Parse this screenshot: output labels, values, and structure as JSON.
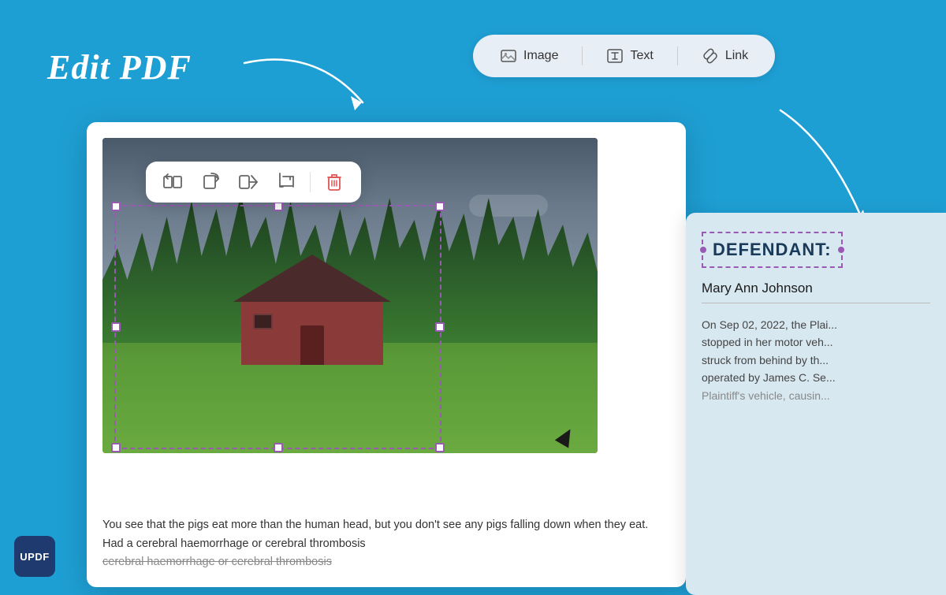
{
  "page": {
    "title": "Edit PDF",
    "background_color": "#1e9fd4"
  },
  "toolbar": {
    "items": [
      {
        "id": "image",
        "label": "Image",
        "icon": "image-icon"
      },
      {
        "id": "text",
        "label": "Text",
        "icon": "text-icon"
      },
      {
        "id": "link",
        "label": "Link",
        "icon": "link-icon"
      }
    ]
  },
  "image_toolbar": {
    "tools": [
      {
        "id": "replace",
        "icon": "replace-icon",
        "tooltip": "Replace"
      },
      {
        "id": "rotate-right",
        "icon": "rotate-right-icon",
        "tooltip": "Rotate Right"
      },
      {
        "id": "extract",
        "icon": "extract-icon",
        "tooltip": "Extract"
      },
      {
        "id": "crop",
        "icon": "crop-icon",
        "tooltip": "Crop"
      },
      {
        "id": "delete",
        "icon": "delete-icon",
        "tooltip": "Delete"
      }
    ]
  },
  "pdf_content": {
    "body_text": "You see that the pigs eat more than the human head, but you don't see any pigs falling down when they eat. Had a cerebral haemorrhage or cerebral thrombosis"
  },
  "right_panel": {
    "defendant_label": "DEFENDANT:",
    "defendant_name": "Mary Ann Johnson",
    "legal_text": "On Sep 02, 2022, the Plai... stopped in her motor veh... struck from behind by th... operated by James C. Se... Plaintiff's vehicle, causin..."
  },
  "logo": {
    "text": "UPDF"
  }
}
